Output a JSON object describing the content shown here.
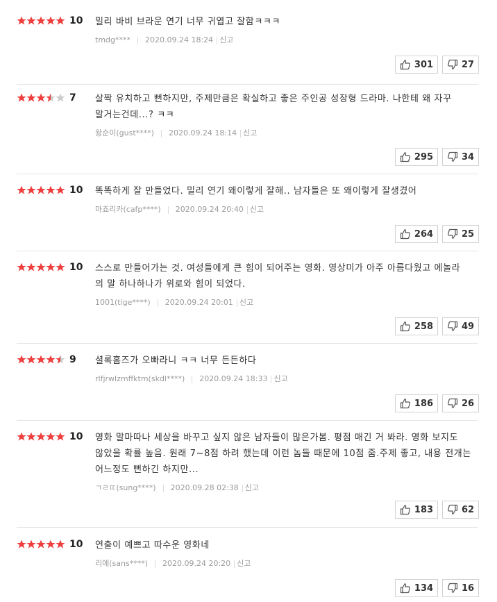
{
  "colors": {
    "star_on": "#ee3e3e",
    "star_off": "#cccccc"
  },
  "report_label": "신고",
  "reviews": [
    {
      "stars": [
        "full",
        "full",
        "full",
        "full",
        "full"
      ],
      "score": "10",
      "lines": [
        "밀리 바비 브라운 연기 너무 귀엽고 잘함ㅋㅋㅋ"
      ],
      "user": "tmdg****",
      "date": "2020.09.24 18:24",
      "likes": "301",
      "dislikes": "27"
    },
    {
      "stars": [
        "full",
        "full",
        "full",
        "half",
        "empty"
      ],
      "score": "7",
      "lines": [
        "살짝 유치하고 뻔하지만, 주제만큼은 확실하고 좋은 주인공 성장형 드라마. 나한테 왜 자꾸",
        "말거는건데...? ㅋㅋ"
      ],
      "user": "왕순이(gust****)",
      "date": "2020.09.24 18:14",
      "likes": "295",
      "dislikes": "34"
    },
    {
      "stars": [
        "full",
        "full",
        "full",
        "full",
        "full"
      ],
      "score": "10",
      "lines": [
        "똑똑하게 잘 만들었다. 밀리 연기 왜이렇게 잘해.. 남자들은 또 왜이렇게 잘생겼어"
      ],
      "user": "마죠리카(cafp****)",
      "date": "2020.09.24 20:40",
      "likes": "264",
      "dislikes": "25"
    },
    {
      "stars": [
        "full",
        "full",
        "full",
        "full",
        "full"
      ],
      "score": "10",
      "lines": [
        "스스로 만들어가는 것. 여성들에게 큰 힘이 되어주는 영화. 영상미가 아주 아름다웠고 에놀라",
        "의 말 하나하나가 위로와 힘이 되었다."
      ],
      "user": "1001(tige****)",
      "date": "2020.09.24 20:01",
      "likes": "258",
      "dislikes": "49"
    },
    {
      "stars": [
        "full",
        "full",
        "full",
        "full",
        "half"
      ],
      "score": "9",
      "lines": [
        "셜록홈즈가 오빠라니 ㅋㅋ 너무 든든하다"
      ],
      "user": "rlfjrwlzmffktm(skdl****)",
      "date": "2020.09.24 18:33",
      "likes": "186",
      "dislikes": "26"
    },
    {
      "stars": [
        "full",
        "full",
        "full",
        "full",
        "full"
      ],
      "score": "10",
      "lines": [
        "영화 말마따나 세상을 바꾸고 싶지 않은 남자들이 많은가봄. 평점 매긴 거 봐라. 영화 보지도",
        "않았을 확률 높음. 원래 7~8점 하려 했는데 이런 놈들 때문에 10점 줌.주제 좋고, 내용 전개는",
        "어느정도 뻔하긴 하지만..."
      ],
      "user": "ㄱㄹㄸ(sung****)",
      "date": "2020.09.28 02:38",
      "likes": "183",
      "dislikes": "62"
    },
    {
      "stars": [
        "full",
        "full",
        "full",
        "full",
        "full"
      ],
      "score": "10",
      "lines": [
        "연출이 예쁘고 따수운 영화네"
      ],
      "user": "리에(sans****)",
      "date": "2020.09.24 20:20",
      "likes": "134",
      "dislikes": "16"
    }
  ]
}
